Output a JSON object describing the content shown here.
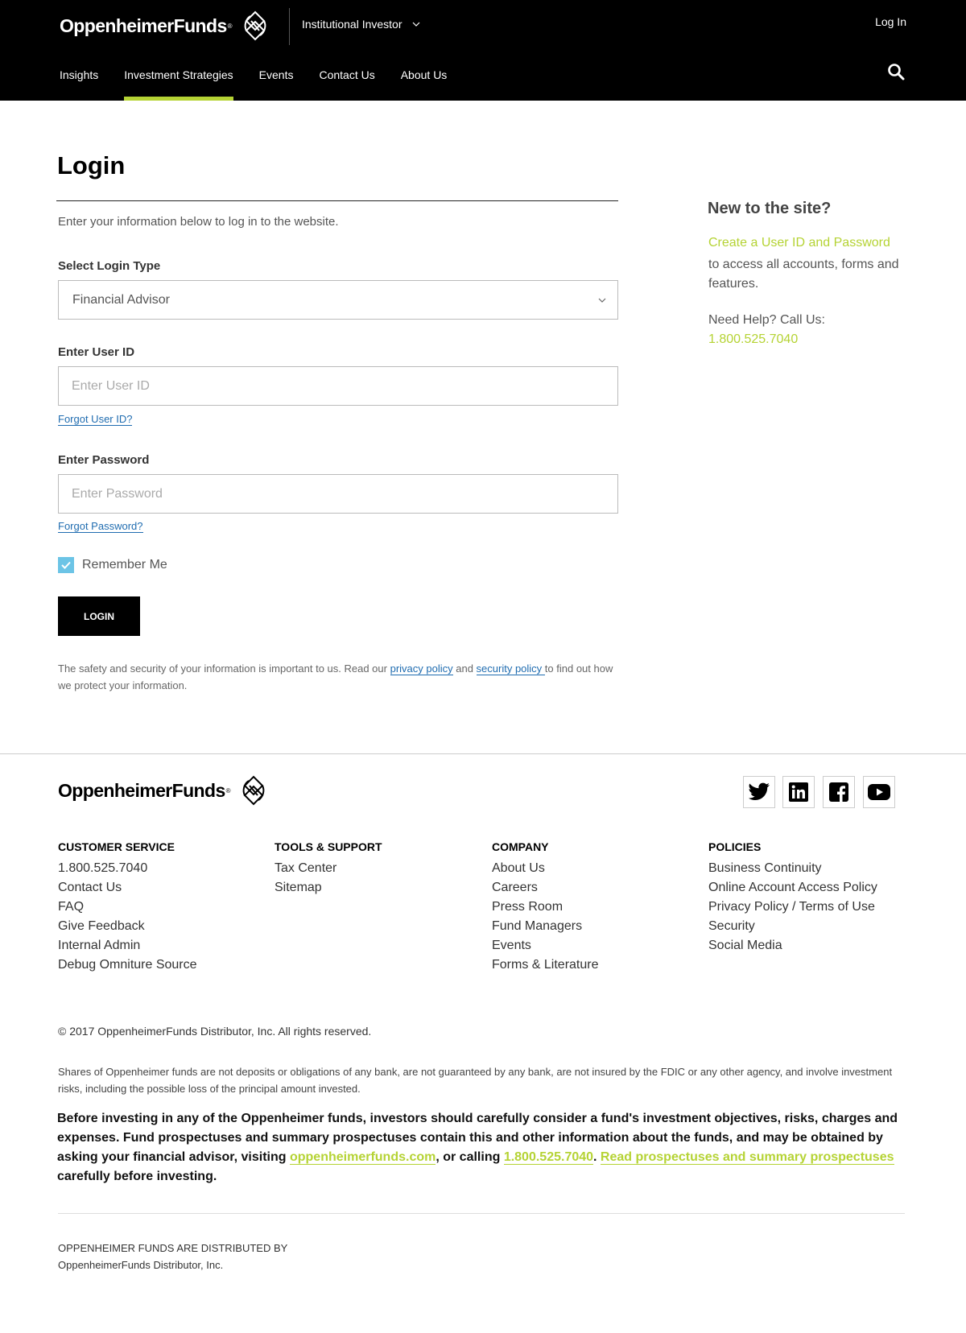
{
  "header": {
    "brand": "OppenheimerFunds",
    "brand_mark": "®",
    "audience": "Institutional Investor",
    "login_link": "Log In",
    "nav": [
      {
        "label": "Insights"
      },
      {
        "label": "Investment Strategies",
        "active": true
      },
      {
        "label": "Events"
      },
      {
        "label": "Contact Us"
      },
      {
        "label": "About Us"
      }
    ],
    "accent_color": "#b5d334"
  },
  "login": {
    "title": "Login",
    "intro": "Enter your information below to log in to the website.",
    "login_type_label": "Select Login Type",
    "login_type_value": "Financial Advisor",
    "user_id_label": "Enter User ID",
    "user_id_placeholder": "Enter User ID",
    "forgot_user_id": "Forgot User ID?",
    "password_label": "Enter Password",
    "password_placeholder": "Enter Password",
    "forgot_password": "Forgot Password?",
    "remember_me": "Remember Me",
    "remember_checked": true,
    "submit_label": "LOGIN",
    "security_note_1": "The safety and security of your information is important to us. Read our ",
    "privacy_policy": "privacy policy",
    "security_note_2": " and ",
    "security_policy": "security policy ",
    "security_note_3": "to find out how we protect your information."
  },
  "sidebar": {
    "title": "New to the site?",
    "create_link": "Create a User ID and Password",
    "create_text": "to access all accounts, forms and features.",
    "help_text": "Need Help? Call Us:",
    "phone": "1.800.525.7040"
  },
  "footer": {
    "brand": "OppenheimerFunds",
    "brand_mark": "®",
    "columns": [
      {
        "title": "CUSTOMER SERVICE",
        "items": [
          "1.800.525.7040",
          "Contact Us",
          "FAQ",
          "Give Feedback",
          "Internal Admin",
          "Debug Omniture Source"
        ]
      },
      {
        "title": "TOOLS & SUPPORT",
        "items": [
          "Tax Center",
          "Sitemap"
        ]
      },
      {
        "title": "COMPANY",
        "items": [
          "About Us",
          "Careers",
          "Press Room",
          "Fund Managers",
          "Events",
          "Forms & Literature"
        ]
      },
      {
        "title": "POLICIES",
        "items": [
          "Business Continuity",
          "Online Account Access Policy",
          "Privacy Policy / Terms of Use",
          "Security",
          "Social Media"
        ]
      }
    ],
    "social": [
      "twitter-icon",
      "linkedin-icon",
      "facebook-icon",
      "youtube-icon"
    ],
    "copyright": "© 2017 OppenheimerFunds Distributor, Inc. All rights reserved.",
    "disclaimer": "Shares of Oppenheimer funds are not deposits or obligations of any bank, are not guaranteed by any bank, are not insured by the FDIC or any other agency, and involve investment risks, including the possible loss of the principal amount invested.",
    "prospectus_1": "Before investing in any of the Oppenheimer funds, investors should carefully consider a fund's investment objectives, risks, charges and expenses. Fund prospectuses and summary prospectuses contain this and other information about the funds, and may be obtained by asking your financial advisor, visiting ",
    "prospectus_site": "oppenheimerfunds.com",
    "prospectus_2": ", or calling ",
    "prospectus_phone": "1.800.525.7040",
    "prospectus_3": ". ",
    "prospectus_link": "Read prospectuses and summary prospectuses",
    "prospectus_4": " carefully before investing.",
    "distributed_line1": "OPPENHEIMER FUNDS ARE DISTRIBUTED BY",
    "distributed_line2": "OppenheimerFunds Distributor, Inc."
  }
}
